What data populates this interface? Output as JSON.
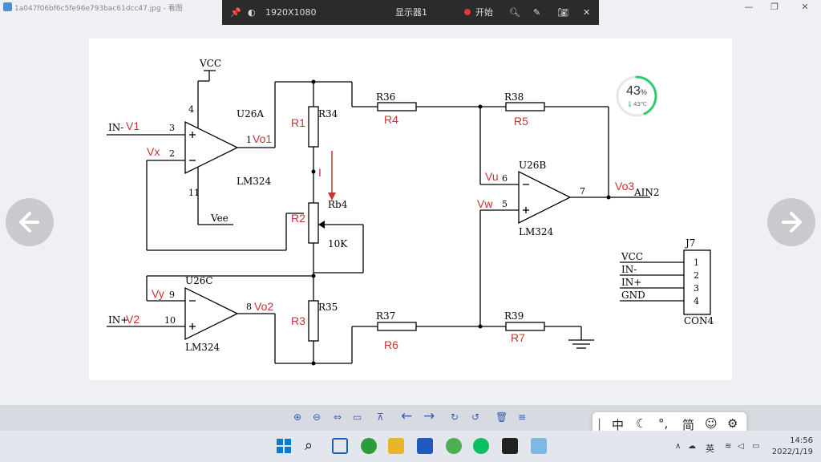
{
  "window": {
    "title": "1a047f06bf6c5fe96e793bac61dcc47.jpg - 看图",
    "min": "—",
    "restore": "❐",
    "close": "✕"
  },
  "capture_toolbar": {
    "resolution": "1920X1080",
    "display": "显示器1",
    "start": "开始"
  },
  "circuit": {
    "vcc": "VCC",
    "vee": "Vee",
    "pin4": "4",
    "pin11": "11",
    "u26a": "U26A",
    "lm324_a": "LM324",
    "in_minus": "IN-",
    "v1": "V1",
    "pin3": "3",
    "vx": "Vx",
    "pin2": "2",
    "pin1": "1",
    "vo1": "Vo1",
    "r1": "R1",
    "r34": "R34",
    "current_i": "I",
    "rb4": "Rb4",
    "r2": "R2",
    "ten_k": "10K",
    "r3": "R3",
    "r35": "R35",
    "u26c": "U26C",
    "vy": "Vy",
    "pin9": "9",
    "pin10": "10",
    "pin8": "8",
    "vo2": "Vo2",
    "in_plus": "IN+",
    "v2": "V2",
    "lm324_c": "LM324",
    "r36": "R36",
    "r4": "R4",
    "r37": "R37",
    "r6": "R6",
    "r38": "R38",
    "r5": "R5",
    "r39": "R39",
    "r7": "R7",
    "u26b": "U26B",
    "vu": "Vu",
    "pin6": "6",
    "vw": "Vw",
    "pin5": "5",
    "pin7": "7",
    "vo3": "Vo3",
    "ain2": "AIN2",
    "lm324_b": "LM324",
    "j7": "J7",
    "con4": "CON4",
    "conn_vcc": "VCC",
    "conn_in_minus": "IN-",
    "conn_in_plus": "IN+",
    "conn_gnd": "GND",
    "conn_1": "1",
    "conn_2": "2",
    "conn_3": "3",
    "conn_4": "4"
  },
  "cpu_widget": {
    "percent": "43",
    "percent_sign": "%",
    "temp": "43℃",
    "level": 0.43
  },
  "ime": {
    "zhong": "中",
    "jian": "简"
  },
  "tray": {
    "lang": "英",
    "time": "14:56",
    "date": "2022/1/19"
  },
  "colors": {
    "accent_red": "#c83232",
    "widget_green": "#2ecc71"
  }
}
